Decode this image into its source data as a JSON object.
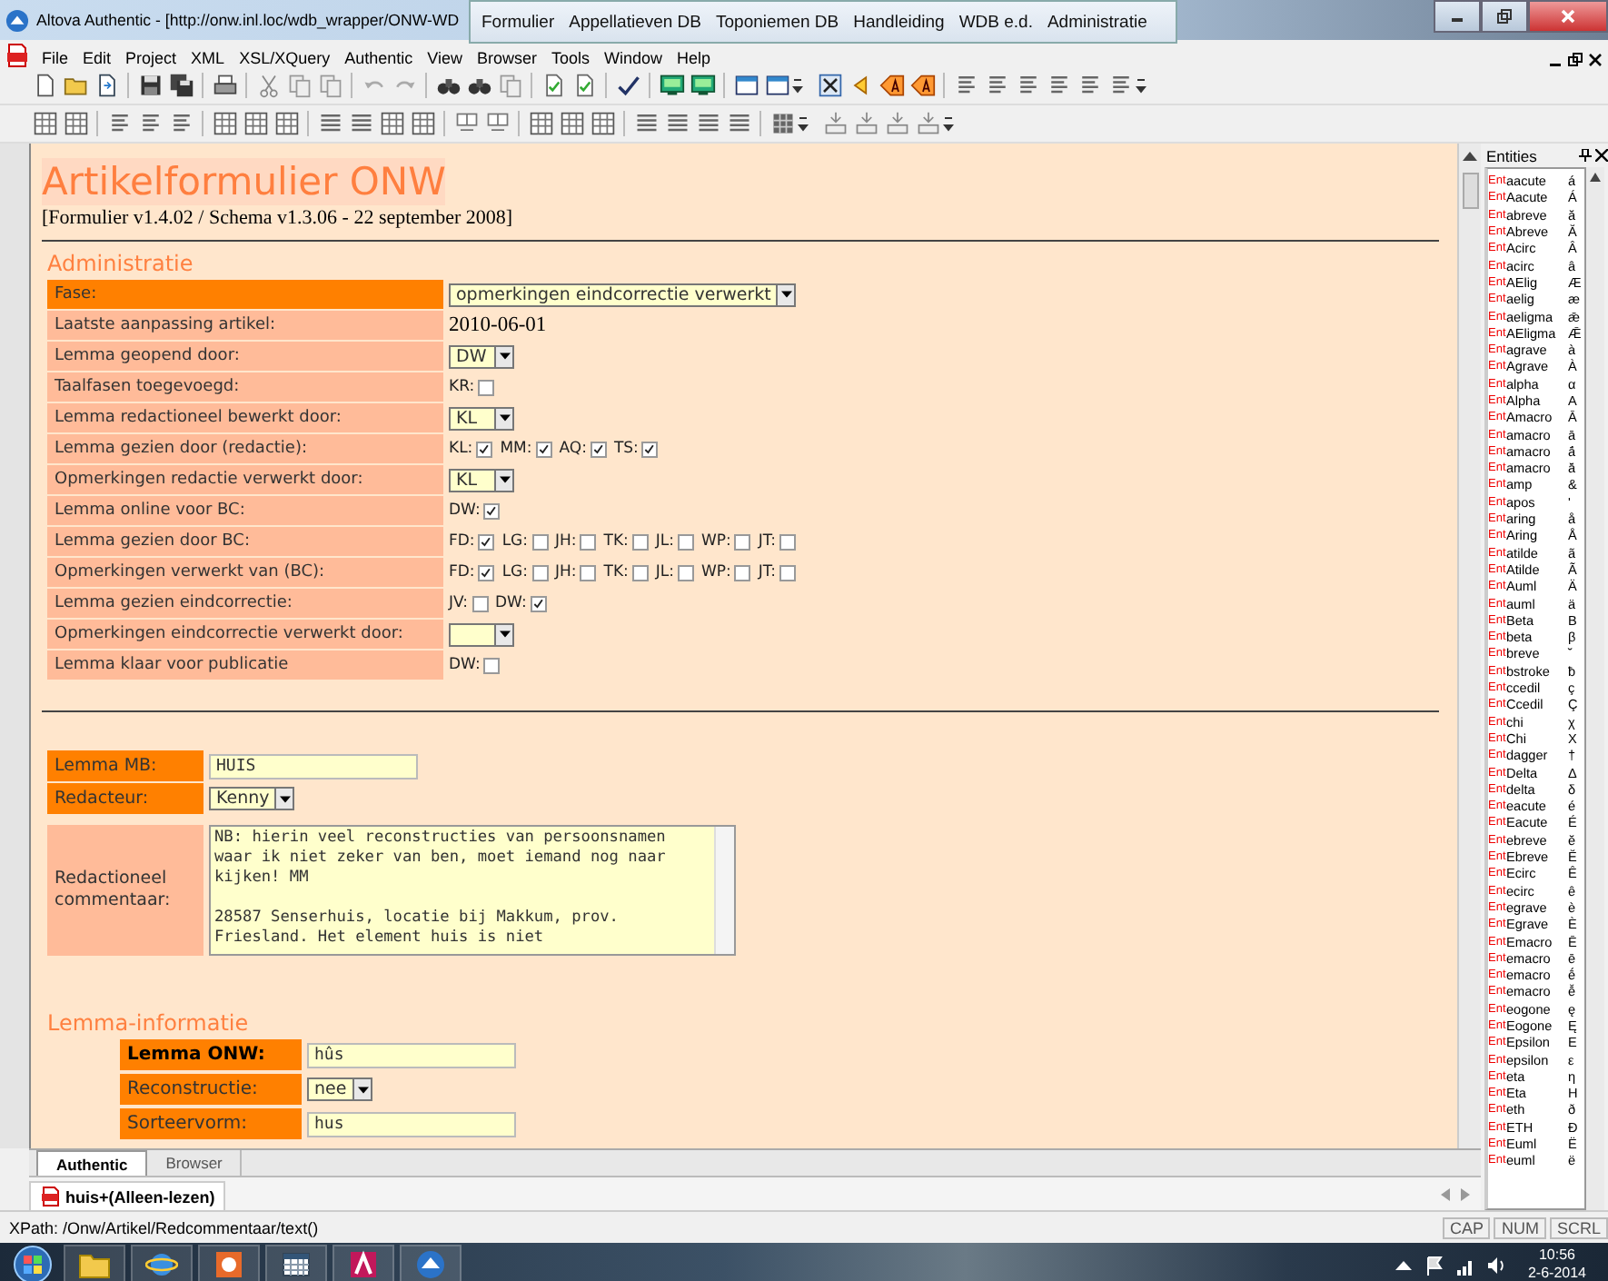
{
  "window": {
    "title": "Altova Authentic - [http://onw.inl.loc/wdb_wrapper/ONW-WD"
  },
  "site_nav": {
    "links": [
      "Formulier",
      "Appellatieven DB",
      "Toponiemen DB",
      "Handleiding",
      "WDB e.d.",
      "Administratie"
    ]
  },
  "menu": [
    "File",
    "Edit",
    "Project",
    "XML",
    "XSL/XQuery",
    "Authentic",
    "View",
    "Browser",
    "Tools",
    "Window",
    "Help"
  ],
  "document": {
    "title": "Artikelformulier ONW",
    "version": "[Formulier v1.4.02 / Schema v1.3.06 -  22 september 2008]",
    "administratie": {
      "heading": "Administratie",
      "rows": [
        {
          "label": "Fase:",
          "highlighted": true,
          "kind": "select",
          "value": "opmerkingen eindcorrectie verwerkt"
        },
        {
          "label": "Laatste aanpassing artikel:",
          "highlighted": false,
          "kind": "text",
          "value": "2010-06-01"
        },
        {
          "label": "Lemma geopend door:",
          "highlighted": false,
          "kind": "select",
          "value": "DW"
        },
        {
          "label": "Taalfasen toegevoegd:",
          "highlighted": false,
          "kind": "checks",
          "items": [
            {
              "label": "KR:",
              "checked": false
            }
          ]
        },
        {
          "label": "Lemma redactioneel bewerkt door:",
          "highlighted": false,
          "kind": "select",
          "value": "KL"
        },
        {
          "label": "Lemma gezien door (redactie):",
          "highlighted": false,
          "kind": "checks",
          "items": [
            {
              "label": "KL:",
              "checked": true
            },
            {
              "label": "MM:",
              "checked": true
            },
            {
              "label": "AQ:",
              "checked": true
            },
            {
              "label": "TS:",
              "checked": true
            }
          ]
        },
        {
          "label": "Opmerkingen redactie verwerkt door:",
          "highlighted": false,
          "kind": "select",
          "value": "KL"
        },
        {
          "label": "Lemma online voor BC:",
          "highlighted": false,
          "kind": "checks",
          "items": [
            {
              "label": "DW:",
              "checked": true
            }
          ]
        },
        {
          "label": "Lemma gezien door BC:",
          "highlighted": false,
          "kind": "checks",
          "items": [
            {
              "label": "FD:",
              "checked": true
            },
            {
              "label": "LG:",
              "checked": false
            },
            {
              "label": "JH:",
              "checked": false
            },
            {
              "label": "TK:",
              "checked": false
            },
            {
              "label": "JL:",
              "checked": false
            },
            {
              "label": "WP:",
              "checked": false
            },
            {
              "label": "JT:",
              "checked": false
            }
          ]
        },
        {
          "label": "Opmerkingen verwerkt van (BC):",
          "highlighted": false,
          "kind": "checks",
          "items": [
            {
              "label": "FD:",
              "checked": true
            },
            {
              "label": "LG:",
              "checked": false
            },
            {
              "label": "JH:",
              "checked": false
            },
            {
              "label": "TK:",
              "checked": false
            },
            {
              "label": "JL:",
              "checked": false
            },
            {
              "label": "WP:",
              "checked": false
            },
            {
              "label": "JT:",
              "checked": false
            }
          ]
        },
        {
          "label": "Lemma gezien eindcorrectie:",
          "highlighted": false,
          "kind": "checks",
          "items": [
            {
              "label": "JV:",
              "checked": false
            },
            {
              "label": "DW:",
              "checked": true
            }
          ]
        },
        {
          "label": "Opmerkingen eindcorrectie verwerkt door:",
          "highlighted": false,
          "kind": "select"
        },
        {
          "label": "Lemma klaar voor publicatie",
          "highlighted": false,
          "kind": "checks",
          "items": [
            {
              "label": "DW:",
              "checked": false
            }
          ]
        }
      ]
    },
    "editor": {
      "rows": [
        {
          "label": "Lemma MB:",
          "highlighted": true,
          "kind": "input",
          "value": "HUIS"
        },
        {
          "label": "Redacteur:",
          "highlighted": true,
          "kind": "select",
          "value": "Kenny"
        },
        {
          "label": "Redactioneel commentaar:",
          "highlighted": false,
          "kind": "textarea",
          "value": "NB: hierin veel reconstructies van persoonsnamen waar ik niet zeker van ben, moet iemand nog naar kijken! MM\n\n28587 Senserhuis, locatie bij Makkum, prov. Friesland. Het element huis is niet"
        }
      ]
    },
    "lemma_info": {
      "heading": "Lemma-informatie",
      "rows": [
        {
          "label": "Lemma ONW:",
          "bold": true,
          "kind": "input",
          "value": "hûs"
        },
        {
          "label": "Reconstructie:",
          "bold": false,
          "kind": "select",
          "value": "nee"
        },
        {
          "label": "Sorteervorm:",
          "bold": false,
          "kind": "input",
          "value": "hus"
        }
      ]
    }
  },
  "view_tabs": [
    {
      "label": "Authentic",
      "selected": true
    },
    {
      "label": "Browser",
      "selected": false
    }
  ],
  "file_tabs": [
    {
      "label": "huis+(Alleen-lezen)",
      "selected": true
    }
  ],
  "entities": {
    "title": "Entities",
    "items": [
      {
        "type": "Ent",
        "name": "aacute",
        "char": "á"
      },
      {
        "type": "Ent",
        "name": "Aacute",
        "char": "Á"
      },
      {
        "type": "Ent",
        "name": "abreve",
        "char": "ă"
      },
      {
        "type": "Ent",
        "name": "Abreve",
        "char": "Ă"
      },
      {
        "type": "Ent",
        "name": "Acirc",
        "char": "Â"
      },
      {
        "type": "Ent",
        "name": "acirc",
        "char": "â"
      },
      {
        "type": "Ent",
        "name": "AElig",
        "char": "Æ"
      },
      {
        "type": "Ent",
        "name": "aelig",
        "char": "æ"
      },
      {
        "type": "Ent",
        "name": "aeligma",
        "char": "ǣ"
      },
      {
        "type": "Ent",
        "name": "AEligma",
        "char": "Ǣ"
      },
      {
        "type": "Ent",
        "name": "agrave",
        "char": "à"
      },
      {
        "type": "Ent",
        "name": "Agrave",
        "char": "À"
      },
      {
        "type": "Ent",
        "name": "alpha",
        "char": "α"
      },
      {
        "type": "Ent",
        "name": "Alpha",
        "char": "Α"
      },
      {
        "type": "Ent",
        "name": "Amacro",
        "char": "Ā"
      },
      {
        "type": "Ent",
        "name": "amacro",
        "char": "ā"
      },
      {
        "type": "Ent",
        "name": "amacro",
        "char": "ā́"
      },
      {
        "type": "Ent",
        "name": "amacro",
        "char": "ā̆"
      },
      {
        "type": "Ent",
        "name": "amp",
        "char": "&"
      },
      {
        "type": "Ent",
        "name": "apos",
        "char": "'"
      },
      {
        "type": "Ent",
        "name": "aring",
        "char": "å"
      },
      {
        "type": "Ent",
        "name": "Aring",
        "char": "Å"
      },
      {
        "type": "Ent",
        "name": "atilde",
        "char": "ã"
      },
      {
        "type": "Ent",
        "name": "Atilde",
        "char": "Ã"
      },
      {
        "type": "Ent",
        "name": "Auml",
        "char": "Ä"
      },
      {
        "type": "Ent",
        "name": "auml",
        "char": "ä"
      },
      {
        "type": "Ent",
        "name": "Beta",
        "char": "Β"
      },
      {
        "type": "Ent",
        "name": "beta",
        "char": "β"
      },
      {
        "type": "Ent",
        "name": "breve",
        "char": "˘"
      },
      {
        "type": "Ent",
        "name": "bstroke",
        "char": "ƀ"
      },
      {
        "type": "Ent",
        "name": "ccedil",
        "char": "ç"
      },
      {
        "type": "Ent",
        "name": "Ccedil",
        "char": "Ç"
      },
      {
        "type": "Ent",
        "name": "chi",
        "char": "χ"
      },
      {
        "type": "Ent",
        "name": "Chi",
        "char": "Χ"
      },
      {
        "type": "Ent",
        "name": "dagger",
        "char": "†"
      },
      {
        "type": "Ent",
        "name": "Delta",
        "char": "Δ"
      },
      {
        "type": "Ent",
        "name": "delta",
        "char": "δ"
      },
      {
        "type": "Ent",
        "name": "eacute",
        "char": "é"
      },
      {
        "type": "Ent",
        "name": "Eacute",
        "char": "É"
      },
      {
        "type": "Ent",
        "name": "ebreve",
        "char": "ĕ"
      },
      {
        "type": "Ent",
        "name": "Ebreve",
        "char": "Ĕ"
      },
      {
        "type": "Ent",
        "name": "Ecirc",
        "char": "Ê"
      },
      {
        "type": "Ent",
        "name": "ecirc",
        "char": "ê"
      },
      {
        "type": "Ent",
        "name": "egrave",
        "char": "è"
      },
      {
        "type": "Ent",
        "name": "Egrave",
        "char": "È"
      },
      {
        "type": "Ent",
        "name": "Emacro",
        "char": "Ē"
      },
      {
        "type": "Ent",
        "name": "emacro",
        "char": "ē"
      },
      {
        "type": "Ent",
        "name": "emacro",
        "char": "ḗ"
      },
      {
        "type": "Ent",
        "name": "emacro",
        "char": "ē̆"
      },
      {
        "type": "Ent",
        "name": "eogone",
        "char": "ę"
      },
      {
        "type": "Ent",
        "name": "Eogone",
        "char": "Ę"
      },
      {
        "type": "Ent",
        "name": "Epsilon",
        "char": "Ε"
      },
      {
        "type": "Ent",
        "name": "epsilon",
        "char": "ε"
      },
      {
        "type": "Ent",
        "name": "eta",
        "char": "η"
      },
      {
        "type": "Ent",
        "name": "Eta",
        "char": "Η"
      },
      {
        "type": "Ent",
        "name": "eth",
        "char": "ð"
      },
      {
        "type": "Ent",
        "name": "ETH",
        "char": "Ð"
      },
      {
        "type": "Ent",
        "name": "Euml",
        "char": "Ë"
      },
      {
        "type": "Ent",
        "name": "euml",
        "char": "ë"
      }
    ]
  },
  "status_bar": {
    "xpath": "XPath: /Onw/Artikel/Redcommentaar/text()",
    "indicators": [
      "CAP",
      "NUM",
      "SCRL"
    ]
  },
  "taskbar": {
    "time": "10:56",
    "date": "2-6-2014"
  }
}
